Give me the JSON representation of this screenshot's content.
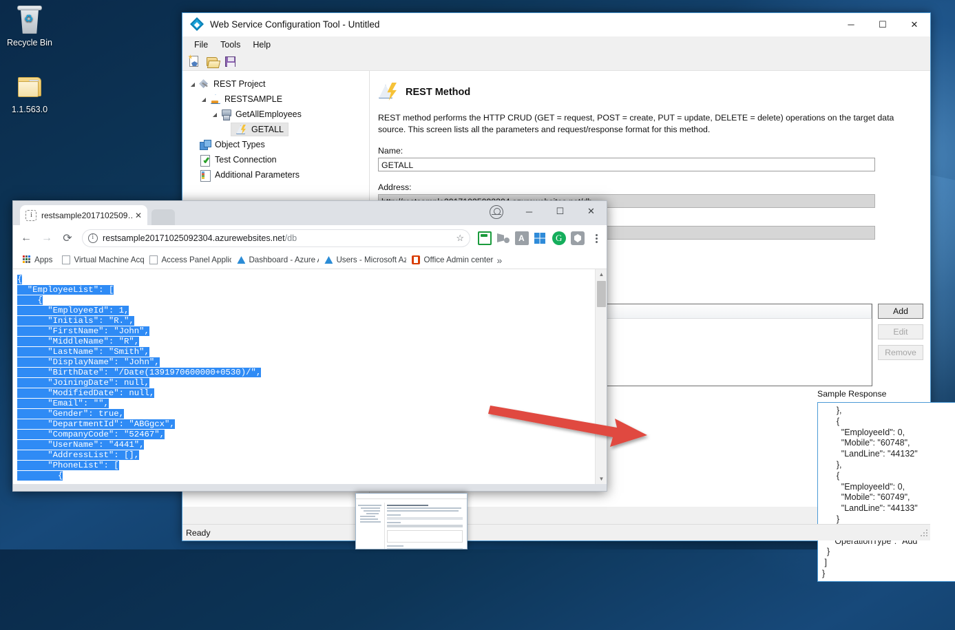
{
  "desktop": {
    "icons": [
      {
        "label": "Recycle Bin",
        "icon": "recycle-bin-icon"
      },
      {
        "label": "1.1.563.0",
        "icon": "folder-icon"
      }
    ]
  },
  "main_window": {
    "title": "Web Service Configuration Tool - Untitled",
    "app_icon": "app-diamond-icon",
    "window_buttons": {
      "minimize": "─",
      "maximize": "☐",
      "close": "✕"
    },
    "menu": [
      "File",
      "Tools",
      "Help"
    ],
    "toolbar": [
      {
        "name": "new-icon",
        "tip": "New"
      },
      {
        "name": "open-icon",
        "tip": "Open"
      },
      {
        "name": "save-icon",
        "tip": "Save"
      }
    ],
    "tree": [
      {
        "label": "REST Project",
        "icon": "project-icon",
        "indent": 0,
        "arrow": "◢",
        "selected": false
      },
      {
        "label": "RESTSAMPLE",
        "icon": "sample-icon",
        "indent": 1,
        "arrow": "◢",
        "selected": false
      },
      {
        "label": "GetAllEmployees",
        "icon": "service-icon",
        "indent": 2,
        "arrow": "◢",
        "selected": false
      },
      {
        "label": "GETALL",
        "icon": "method-icon",
        "indent": 3,
        "arrow": "",
        "selected": true
      },
      {
        "label": "Object Types",
        "icon": "object-types-icon",
        "indent": 1,
        "arrow": "",
        "selected": false
      },
      {
        "label": "Test Connection",
        "icon": "test-connection-icon",
        "indent": 1,
        "arrow": "",
        "selected": false
      },
      {
        "label": "Additional Parameters",
        "icon": "additional-parameters-icon",
        "indent": 1,
        "arrow": "",
        "selected": false
      }
    ],
    "pane": {
      "icon": "rest-method-icon",
      "heading": "REST Method",
      "description": "REST method performs the HTTP CRUD (GET = request, POST = create, PUT = update, DELETE = delete) operations on the target data source. This screen lists all the parameters and request/response format for this method.",
      "name_label": "Name:",
      "name_value": "GETALL",
      "address_label": "Address:",
      "address_value": "http://restsample20171025092304.azurewebsites.net/db"
    },
    "side_buttons": [
      {
        "label": "Add",
        "enabled": true
      },
      {
        "label": "Edit",
        "enabled": false
      },
      {
        "label": "Remove",
        "enabled": false
      }
    ],
    "sample_response": {
      "label": "Sample Response",
      "text": "      },\n      {\n        \"EmployeeId\": 0,\n        \"Mobile\": \"60748\",\n        \"LandLine\": \"44132\"\n      },\n      {\n        \"EmployeeId\": 0,\n        \"Mobile\": \"60749\",\n        \"LandLine\": \"44133\"\n      }\n    ],\n    \"OperationType\": \"Add\"\n  }\n ]\n}"
    },
    "status_bar": {
      "text": "Ready",
      "grip": "resize-grip-icon"
    }
  },
  "browser": {
    "tab": {
      "title": "restsample2017102509…",
      "favicon": "page-info-icon",
      "close": "✕"
    },
    "new_tab": "+",
    "profile_icon": "profile-icon",
    "window_buttons": {
      "minimize": "─",
      "maximize": "☐",
      "close": "✕"
    },
    "nav": {
      "back": "←",
      "forward": "→",
      "reload": "⟳"
    },
    "omnibox": {
      "security_icon": "site-info-icon",
      "url_host": "restsample20171025092304.azurewebsites.net",
      "url_path": "/db",
      "star_icon": "bookmark-star-icon"
    },
    "extensions": [
      "extension-green-icon",
      "extension-video-icon",
      "extension-a-icon",
      "extension-windows-icon",
      "extension-grammarly-icon",
      "extension-shield-icon"
    ],
    "menu_icon": "chrome-menu-icon",
    "bookmarks": [
      {
        "label": "Apps",
        "icon": "apps-grid-icon"
      },
      {
        "label": "Virtual Machine Acqu",
        "icon": "page-icon"
      },
      {
        "label": "Access Panel Applicat",
        "icon": "page-icon"
      },
      {
        "label": "Dashboard - Azure A",
        "icon": "azure-icon"
      },
      {
        "label": "Users - Microsoft Azu",
        "icon": "azure-icon"
      },
      {
        "label": "Office Admin center",
        "icon": "office-icon"
      }
    ],
    "bookmarks_overflow": "»",
    "page_json": "{\n  \"EmployeeList\": [\n    {\n      \"EmployeeId\": 1,\n      \"Initials\": \"R.\",\n      \"FirstName\": \"John\",\n      \"MiddleName\": \"R\",\n      \"LastName\": \"Smith\",\n      \"DisplayName\": \"John\",\n      \"BirthDate\": \"/Date(1391970600000+0530)/\",\n      \"JoiningDate\": null,\n      \"ModifiedDate\": null,\n      \"Email\": \"\",\n      \"Gender\": true,\n      \"DepartmentId\": \"ABGgcx\",\n      \"CompanyCode\": \"52467\",\n      \"UserName\": \"4441\",\n      \"AddressList\": [],\n      \"PhoneList\": [\n        {",
    "scroll": {
      "up": "▲",
      "down": "▼"
    }
  },
  "annotation": {
    "arrow_color": "#e04a3f",
    "name": "red-arrow-annotation"
  },
  "colors": {
    "accent": "#4b9ad6",
    "selection": "#2f8bf5",
    "desktop": "#0d3557"
  }
}
